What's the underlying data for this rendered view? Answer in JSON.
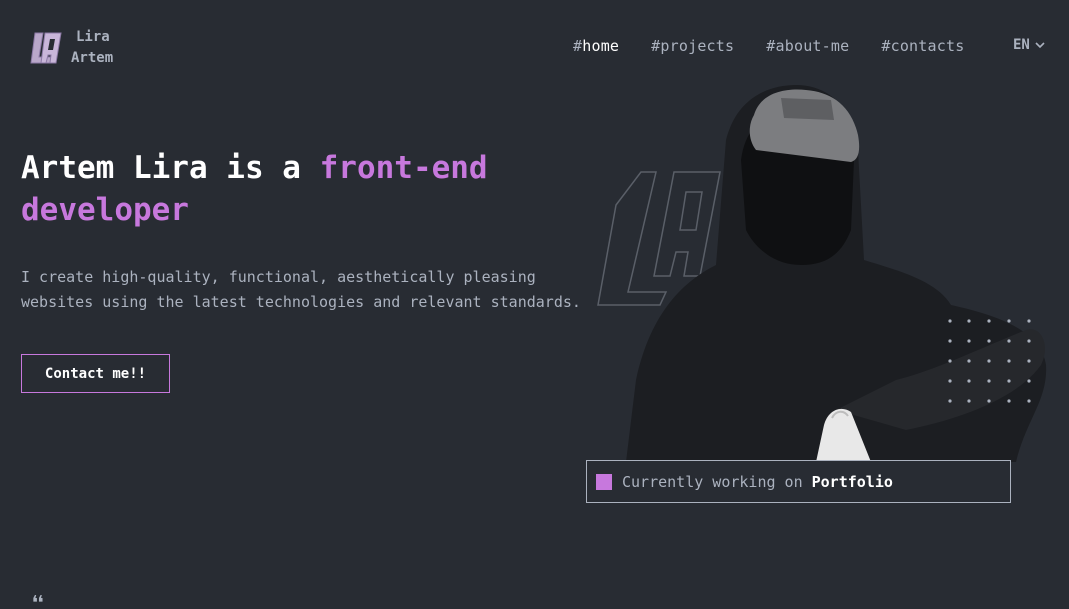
{
  "header": {
    "logo": {
      "line1": "Lira",
      "line2": "Artem",
      "icon": "la-logo-icon"
    },
    "nav": [
      {
        "hash": "#",
        "label": "home",
        "active": true
      },
      {
        "hash": "#",
        "label": "projects",
        "active": false
      },
      {
        "hash": "#",
        "label": "about-me",
        "active": false
      },
      {
        "hash": "#",
        "label": "contacts",
        "active": false
      }
    ],
    "lang": {
      "label": "EN",
      "icon": "chevron-down-icon"
    }
  },
  "hero": {
    "title_prefix": "Artem Lira is a ",
    "title_accent1": "front-end",
    "title_accent2": "developer",
    "description": "I create high-quality, functional, aesthetically pleasing websites using the latest technologies and relevant standards.",
    "contact_button": "Contact me!!"
  },
  "status": {
    "prefix": "Currently working on",
    "project": "Portfolio"
  },
  "colors": {
    "background": "#282c33",
    "text": "#abb2bf",
    "accent": "#c778dd",
    "white": "#ffffff"
  },
  "icons": [
    "la-logo-icon",
    "chevron-down-icon",
    "dots-decoration",
    "quote-icon"
  ]
}
